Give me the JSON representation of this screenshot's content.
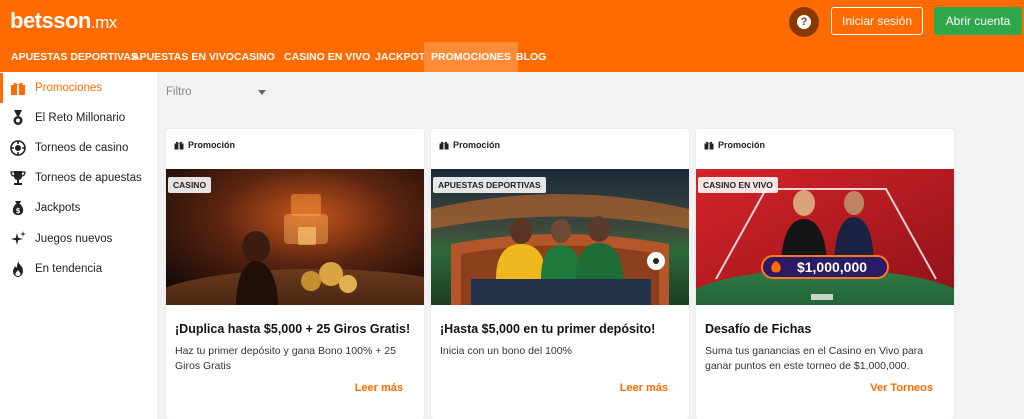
{
  "header": {
    "logo_main": "betsson",
    "logo_tld": ".mx",
    "help_label": "?",
    "login_label": "Iniciar sesión",
    "register_label": "Abrir cuenta"
  },
  "nav": {
    "items": [
      {
        "label": "APUESTAS DEPORTIVAS"
      },
      {
        "label": "APUESTAS EN VIVO"
      },
      {
        "label": "CASINO"
      },
      {
        "label": "CASINO EN VIVO"
      },
      {
        "label": "JACKPOT"
      },
      {
        "label": "PROMOCIONES",
        "active": true
      },
      {
        "label": "BLOG"
      }
    ]
  },
  "sidebar": {
    "items": [
      {
        "label": "Promociones",
        "icon": "gift-icon",
        "active": true
      },
      {
        "label": "El Reto Millonario",
        "icon": "medal-icon"
      },
      {
        "label": "Torneos de casino",
        "icon": "casino-chip-icon"
      },
      {
        "label": "Torneos de apuestas",
        "icon": "trophy-icon"
      },
      {
        "label": "Jackpots",
        "icon": "money-bag-icon"
      },
      {
        "label": "Juegos nuevos",
        "icon": "sparkle-icon"
      },
      {
        "label": "En tendencia",
        "icon": "flame-icon"
      }
    ]
  },
  "filter": {
    "placeholder": "Filtro"
  },
  "cards": [
    {
      "type_label": "Promoción",
      "tag": "CASINO",
      "title": "¡Duplica hasta $5,000 + 25 Giros Gratis!",
      "description": "Haz tu primer depósito y gana Bono 100% + 25 Giros Gratis",
      "link": "Leer más"
    },
    {
      "type_label": "Promoción",
      "tag": "APUESTAS DEPORTIVAS",
      "title": "¡Hasta $5,000 en tu primer depósito!",
      "description": "Inicia con un bono del 100%",
      "link": "Leer más"
    },
    {
      "type_label": "Promoción",
      "tag": "CASINO EN VIVO",
      "title": "Desafío de Fichas",
      "description": "Suma tus ganancias en el Casino en Vivo para ganar puntos en este torneo de $1,000,000.",
      "link": "Ver Torneos",
      "banner_amount": "$1,000,000"
    }
  ],
  "colors": {
    "brand_orange": "#ff6b00",
    "register_green": "#2ea84a",
    "active_nav_bg": "#ff8b36"
  }
}
